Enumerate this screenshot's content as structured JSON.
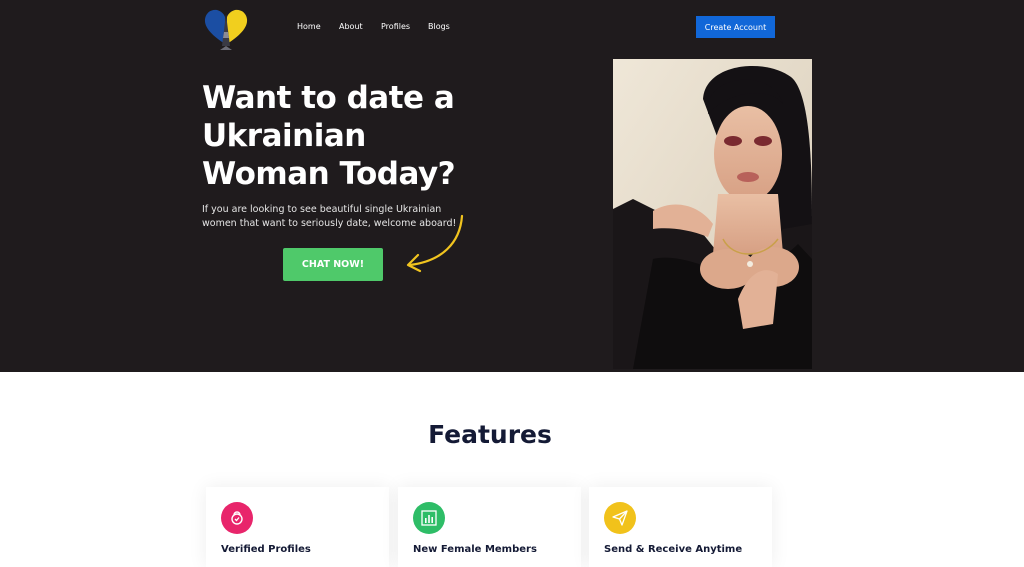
{
  "nav": {
    "items": [
      {
        "label": "Home"
      },
      {
        "label": "About"
      },
      {
        "label": "Profiles"
      },
      {
        "label": "Blogs"
      }
    ],
    "create_account": "Create Account"
  },
  "hero": {
    "title": "Want to date a Ukrainian Woman Today?",
    "subtitle": "If you are looking to see beautiful single Ukrainian women that want to seriously date, welcome aboard!",
    "cta": "CHAT NOW!"
  },
  "features": {
    "title": "Features",
    "cards": [
      {
        "title": "Verified Profiles",
        "icon": "lock-icon",
        "color": "#e8256b"
      },
      {
        "title": "New Female Members",
        "icon": "bar-chart-icon",
        "color": "#2ebd67"
      },
      {
        "title": "Send & Receive Anytime",
        "icon": "send-icon",
        "color": "#f1c21b"
      }
    ]
  },
  "colors": {
    "hero_bg": "#1f1b1d",
    "cta_green": "#4fc96a",
    "primary_blue": "#1167d8",
    "arrow_yellow": "#f1c41f"
  }
}
